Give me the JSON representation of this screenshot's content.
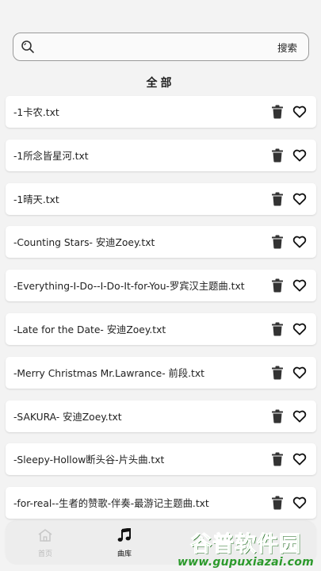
{
  "search": {
    "placeholder": "",
    "value": "",
    "button_label": "搜索"
  },
  "section_title": "全部",
  "songs": [
    {
      "label": "-1卡农.txt"
    },
    {
      "label": "-1所念皆星河.txt"
    },
    {
      "label": "-1晴天.txt"
    },
    {
      "label": "-Counting Stars- 安迪Zoey.txt"
    },
    {
      "label": "-Everything-I-Do--I-Do-It-for-You-罗宾汉主题曲.txt"
    },
    {
      "label": "-Late for the Date- 安迪Zoey.txt"
    },
    {
      "label": "-Merry Christmas Mr.Lawrance- 前段.txt"
    },
    {
      "label": "-SAKURA- 安迪Zoey.txt"
    },
    {
      "label": "-Sleepy-Hollow断头谷-片头曲.txt"
    },
    {
      "label": "-for-real--生者的赞歌-伴奏-最游记主题曲.txt"
    }
  ],
  "nav": {
    "home_label": "首页",
    "library_label": "曲库"
  },
  "watermark": {
    "main": "谷普软件园",
    "url": "www.gupuxiazai.com"
  },
  "colors": {
    "background": "#f3f3f3",
    "card": "#ffffff",
    "watermark_green": "#3cb23c"
  }
}
